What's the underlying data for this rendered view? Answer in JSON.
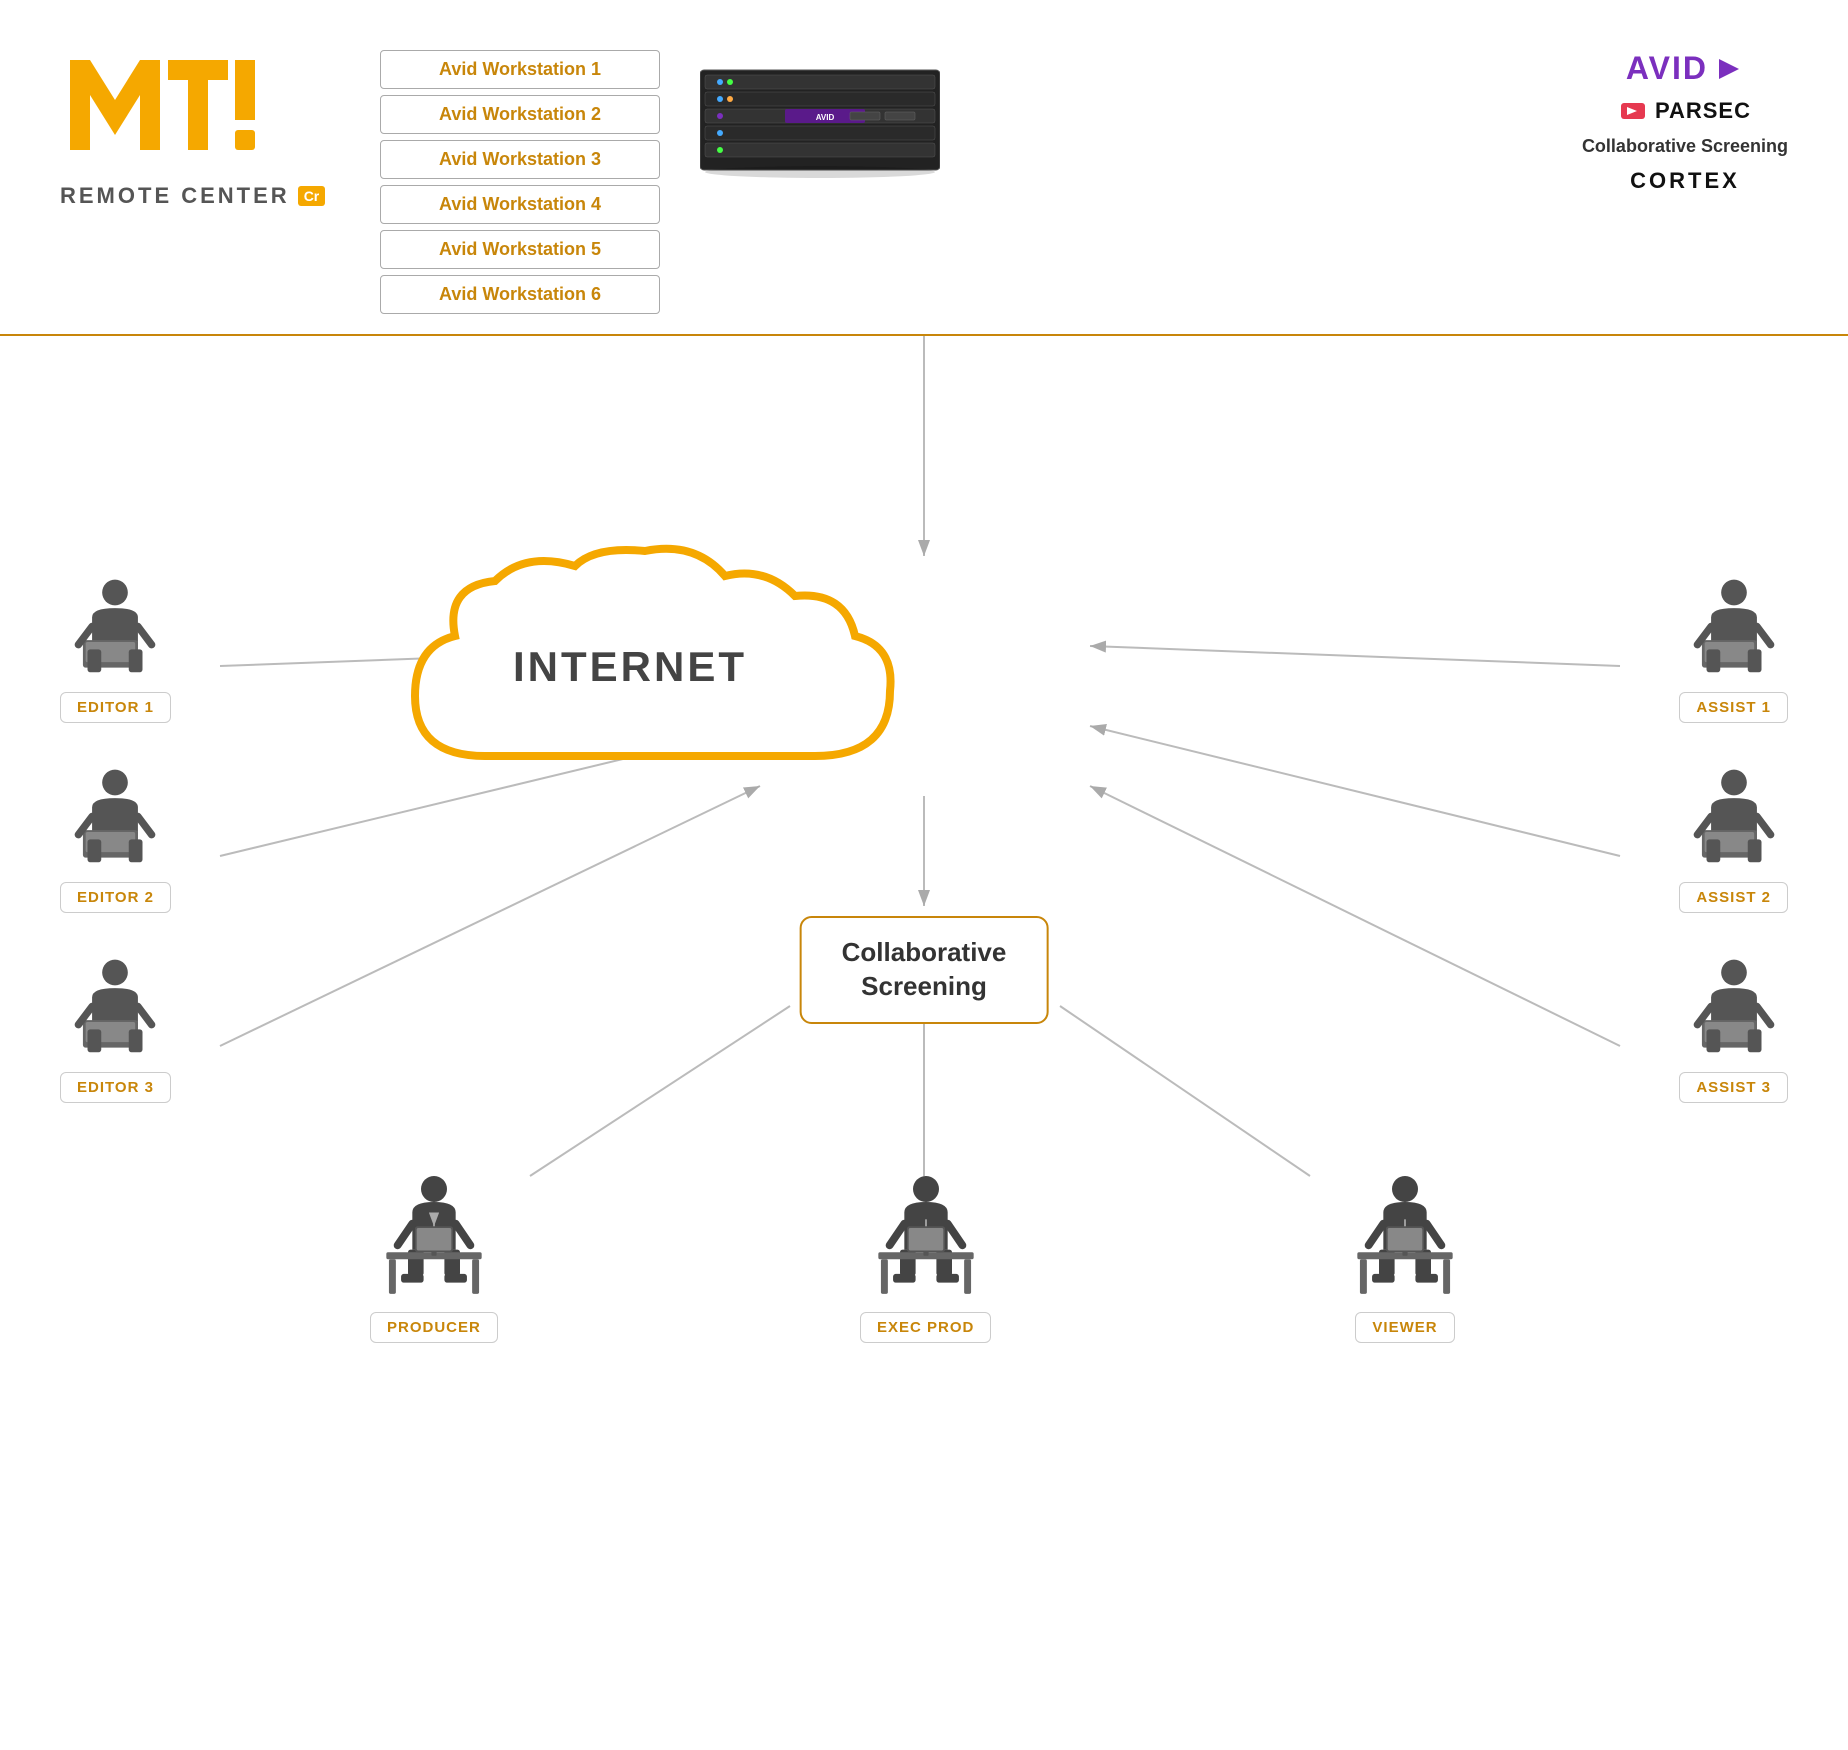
{
  "mti": {
    "logo_text": "MTI",
    "remote_center": "REMOTE CENTER",
    "cr_badge": "Cr"
  },
  "workstations": [
    {
      "label": "Avid Workstation 1"
    },
    {
      "label": "Avid Workstation 2"
    },
    {
      "label": "Avid Workstation 3"
    },
    {
      "label": "Avid Workstation 4"
    },
    {
      "label": "Avid Workstation 5"
    },
    {
      "label": "Avid Workstation 6"
    }
  ],
  "right_logos": {
    "avid": "AVID",
    "parsec": "PARSEC",
    "collab_screening": "Collaborative Screening",
    "cortex": "CORTEX"
  },
  "diagram": {
    "cloud_label": "INTERNET",
    "collab_box_line1": "Collaborative",
    "collab_box_line2": "Screening",
    "editors": [
      {
        "label": "EDITOR 1"
      },
      {
        "label": "EDITOR 2"
      },
      {
        "label": "EDITOR 3"
      }
    ],
    "assists": [
      {
        "label": "ASSIST 1"
      },
      {
        "label": "ASSIST 2"
      },
      {
        "label": "ASSIST 3"
      }
    ],
    "bottom": [
      {
        "label": "PRODUCER"
      },
      {
        "label": "EXEC PROD"
      },
      {
        "label": "VIEWER"
      }
    ]
  }
}
